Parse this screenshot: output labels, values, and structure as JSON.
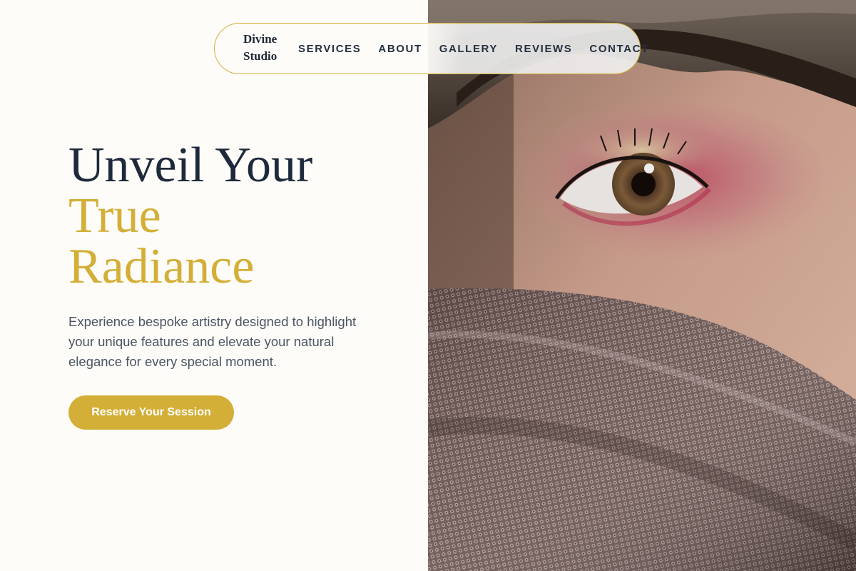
{
  "brand": {
    "name_line1": "Divine",
    "name_line2": "Studio"
  },
  "nav": {
    "items": [
      {
        "label": "SERVICES"
      },
      {
        "label": "ABOUT"
      },
      {
        "label": "GALLERY"
      },
      {
        "label": "REVIEWS"
      },
      {
        "label": "CONTACT"
      }
    ]
  },
  "hero": {
    "title_line1": "Unveil Your",
    "title_line2": "True",
    "title_line3": "Radiance",
    "description": "Experience bespoke artistry designed to highlight your unique features and elevate your natural elegance for every special moment.",
    "cta_label": "Reserve Your Session"
  },
  "colors": {
    "accent_gold": "#d4af37",
    "heading_dark": "#1e293b",
    "body_text": "#4b5563",
    "page_background": "#fdfcf8"
  }
}
